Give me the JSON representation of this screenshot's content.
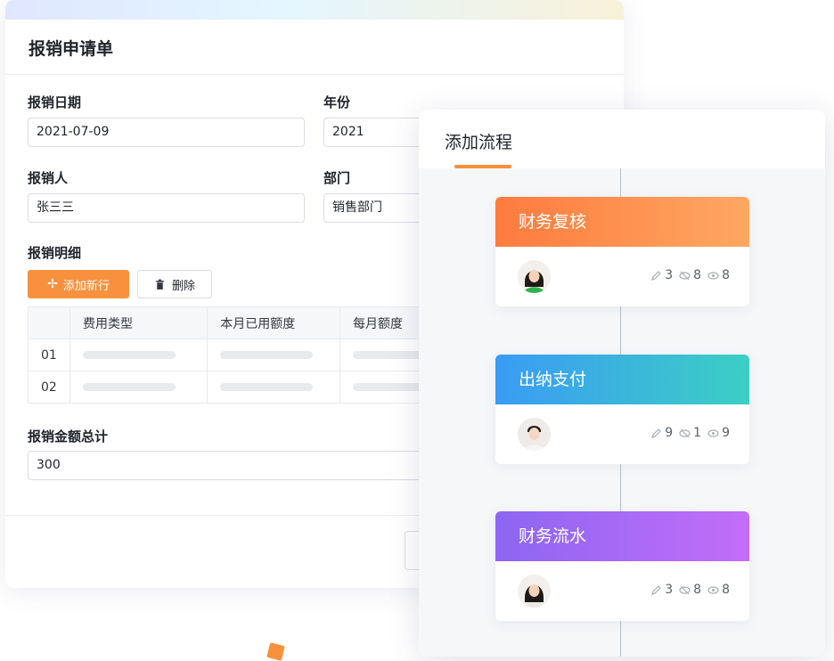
{
  "form": {
    "title": "报销申请单",
    "fields": {
      "date": {
        "label": "报销日期",
        "value": "2021-07-09"
      },
      "year": {
        "label": "年份",
        "value": "2021"
      },
      "person": {
        "label": "报销人",
        "value": "张三三"
      },
      "department": {
        "label": "部门",
        "value": "销售部门"
      }
    },
    "details": {
      "label": "报销明细",
      "add_label": "添加新行",
      "delete_label": "删除",
      "columns": [
        "",
        "费用类型",
        "本月已用额度",
        "每月额度"
      ],
      "rows": [
        "01",
        "02"
      ]
    },
    "total": {
      "label": "报销金额总计",
      "value": "300"
    }
  },
  "process": {
    "title": "添加流程",
    "steps": [
      {
        "name": "财务复核",
        "edit": "3",
        "view": "8",
        "watch": "8",
        "color_from": "#fe7b3e",
        "color_to": "#fea862"
      },
      {
        "name": "出纳支付",
        "edit": "9",
        "view": "1",
        "watch": "9",
        "color_from": "#3a9bf4",
        "color_to": "#3ccfc4"
      },
      {
        "name": "财务流水",
        "edit": "3",
        "view": "8",
        "watch": "8",
        "color_from": "#8c66f2",
        "color_to": "#c36df8"
      }
    ]
  },
  "colors": {
    "accent": "#f7913d",
    "border": "#d9dce3",
    "text": "#1f2329"
  }
}
